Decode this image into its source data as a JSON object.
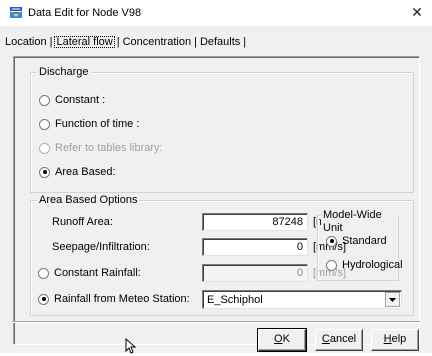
{
  "window": {
    "title": "Data Edit for Node V98",
    "close_glyph": "✕"
  },
  "tabs": [
    {
      "label": "Location"
    },
    {
      "label": "Lateral flow"
    },
    {
      "label": "Concentration"
    },
    {
      "label": "Defaults"
    }
  ],
  "tab_separator": "|",
  "discharge": {
    "title": "Discharge",
    "options": [
      {
        "label": "Constant :"
      },
      {
        "label": "Function of time :"
      },
      {
        "label": "Refer to tables library:"
      },
      {
        "label": "Area Based:"
      }
    ]
  },
  "area_based_options": {
    "title": "Area Based Options",
    "runoff_area": {
      "label": "Runoff Area:",
      "value": "87248",
      "unit": "[m2]"
    },
    "seepage": {
      "label": "Seepage/Infiltration:",
      "value": "0",
      "unit": "[mm/s]"
    },
    "constant_rainfall": {
      "label": "Constant Rainfall:",
      "value": "0",
      "unit": "[mm/s]"
    },
    "rainfall_meteo": {
      "label": "Rainfall from Meteo Station:",
      "value": "E_Schiphol"
    }
  },
  "model_wide_unit": {
    "title": "Model-Wide Unit",
    "options": [
      {
        "label": "Standard"
      },
      {
        "label": "Hydrological"
      }
    ]
  },
  "buttons": {
    "ok": {
      "prefix": "",
      "accel": "O",
      "rest": "K"
    },
    "cancel": {
      "prefix": "",
      "accel": "C",
      "rest": "ancel"
    },
    "help": {
      "prefix": "",
      "accel": "H",
      "rest": "elp"
    }
  },
  "icons": {
    "app": "app-icon",
    "close": "close-icon",
    "combo_arrow": "chevron-down-icon",
    "cursor": "mouse-pointer-icon"
  }
}
